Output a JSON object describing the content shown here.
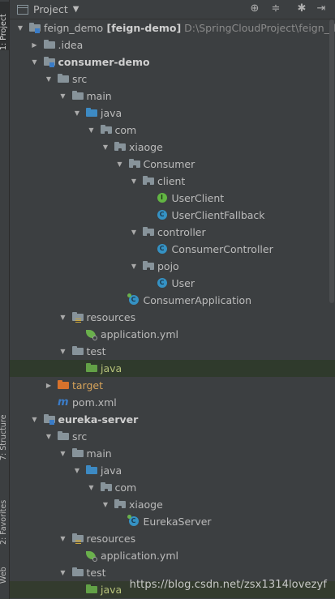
{
  "header": {
    "title": "Project",
    "dropdown_icon": "chevron-down-icon",
    "buttons": [
      "locate-icon",
      "collapse-icon",
      "settings-icon",
      "hide-icon"
    ]
  },
  "side_tabs": [
    "1: Project",
    "7: Structure",
    "2: Favorites",
    "Web"
  ],
  "tree": [
    {
      "level": 0,
      "arrow": "down",
      "icon": "module",
      "label": "feign_demo",
      "label_bold": "[feign-demo]",
      "path": "D:\\SpringCloudProject\\feign_demo"
    },
    {
      "level": 1,
      "arrow": "right",
      "icon": "folder-grey",
      "label": ".idea"
    },
    {
      "level": 1,
      "arrow": "down",
      "icon": "module",
      "label": "consumer-demo",
      "bold": true
    },
    {
      "level": 2,
      "arrow": "down",
      "icon": "folder-grey",
      "label": "src"
    },
    {
      "level": 3,
      "arrow": "down",
      "icon": "folder-grey",
      "label": "main"
    },
    {
      "level": 4,
      "arrow": "down",
      "icon": "folder-blue",
      "label": "java"
    },
    {
      "level": 5,
      "arrow": "down",
      "icon": "package",
      "label": "com"
    },
    {
      "level": 6,
      "arrow": "down",
      "icon": "package",
      "label": "xiaoge"
    },
    {
      "level": 7,
      "arrow": "down",
      "icon": "package",
      "label": "Consumer"
    },
    {
      "level": 8,
      "arrow": "down",
      "icon": "package",
      "label": "client"
    },
    {
      "level": 9,
      "arrow": "none",
      "icon": "interface",
      "label": "UserClient"
    },
    {
      "level": 9,
      "arrow": "none",
      "icon": "class",
      "label": "UserClientFallback"
    },
    {
      "level": 8,
      "arrow": "down",
      "icon": "package",
      "label": "controller"
    },
    {
      "level": 9,
      "arrow": "none",
      "icon": "class",
      "label": "ConsumerController"
    },
    {
      "level": 8,
      "arrow": "down",
      "icon": "package",
      "label": "pojo"
    },
    {
      "level": 9,
      "arrow": "none",
      "icon": "class",
      "label": "User"
    },
    {
      "level": 7,
      "arrow": "none",
      "icon": "spring-class",
      "label": "ConsumerApplication"
    },
    {
      "level": 3,
      "arrow": "down",
      "icon": "resources",
      "label": "resources"
    },
    {
      "level": 4,
      "arrow": "none",
      "icon": "spring-yml",
      "label": "application.yml"
    },
    {
      "level": 3,
      "arrow": "down",
      "icon": "folder-grey",
      "label": "test"
    },
    {
      "level": 4,
      "arrow": "none",
      "icon": "folder-green",
      "label": "java",
      "style": "green",
      "row": "hl"
    },
    {
      "level": 2,
      "arrow": "right",
      "icon": "folder-orange",
      "label": "target",
      "style": "tgt"
    },
    {
      "level": 2,
      "arrow": "none",
      "icon": "maven",
      "label": "pom.xml"
    },
    {
      "level": 1,
      "arrow": "down",
      "icon": "module",
      "label": "eureka-server",
      "bold": true
    },
    {
      "level": 2,
      "arrow": "down",
      "icon": "folder-grey",
      "label": "src"
    },
    {
      "level": 3,
      "arrow": "down",
      "icon": "folder-grey",
      "label": "main"
    },
    {
      "level": 4,
      "arrow": "down",
      "icon": "folder-blue",
      "label": "java"
    },
    {
      "level": 5,
      "arrow": "down",
      "icon": "package",
      "label": "com"
    },
    {
      "level": 6,
      "arrow": "down",
      "icon": "package",
      "label": "xiaoge"
    },
    {
      "level": 7,
      "arrow": "none",
      "icon": "spring-class",
      "label": "EurekaServer"
    },
    {
      "level": 3,
      "arrow": "down",
      "icon": "resources",
      "label": "resources"
    },
    {
      "level": 4,
      "arrow": "none",
      "icon": "spring-yml",
      "label": "application.yml"
    },
    {
      "level": 3,
      "arrow": "down",
      "icon": "folder-grey",
      "label": "test"
    },
    {
      "level": 4,
      "arrow": "none",
      "icon": "folder-green",
      "label": "java",
      "style": "green",
      "row": "ul"
    }
  ],
  "watermark": "https://blog.csdn.net/zsx1314lovezyf"
}
